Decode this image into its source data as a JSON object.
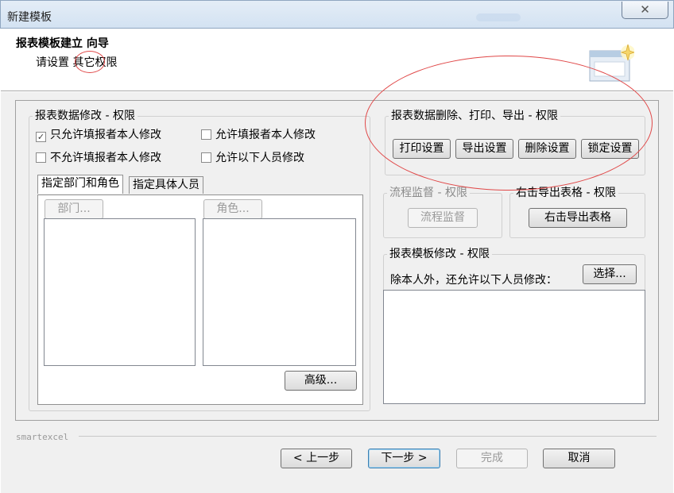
{
  "window": {
    "title": "新建模板",
    "close_glyph": "✕"
  },
  "header": {
    "title": "报表模板建立 向导",
    "subtitle": "请设置 其它权限"
  },
  "modify_group": {
    "legend": "报表数据修改 - 权限",
    "options": [
      {
        "label": "只允许填报者本人修改",
        "checked": true
      },
      {
        "label": "允许填报者本人修改",
        "checked": false
      },
      {
        "label": "不允许填报者本人修改",
        "checked": false
      },
      {
        "label": "允许以下人员修改",
        "checked": false
      }
    ],
    "tabs": [
      {
        "label": "指定部门和角色"
      },
      {
        "label": "指定具体人员"
      }
    ],
    "dept_button": "部门...",
    "role_button": "角色...",
    "advanced_button": "高级..."
  },
  "delete_group": {
    "legend": "报表数据删除、打印、导出 - 权限",
    "buttons": [
      "打印设置",
      "导出设置",
      "删除设置",
      "锁定设置"
    ]
  },
  "flow_group": {
    "legend": "流程监督 - 权限",
    "button": "流程监督"
  },
  "export_group": {
    "legend": "右击导出表格 - 权限",
    "button": "右击导出表格"
  },
  "template_group": {
    "legend": "报表模板修改 - 权限",
    "label": "除本人外，还允许以下人员修改：",
    "select_button": "选择..."
  },
  "footer": {
    "brand": "smartexcel",
    "prev_button": "< 上一步",
    "next_button": "下一步 >",
    "finish_button": "完成",
    "cancel_button": "取消"
  }
}
